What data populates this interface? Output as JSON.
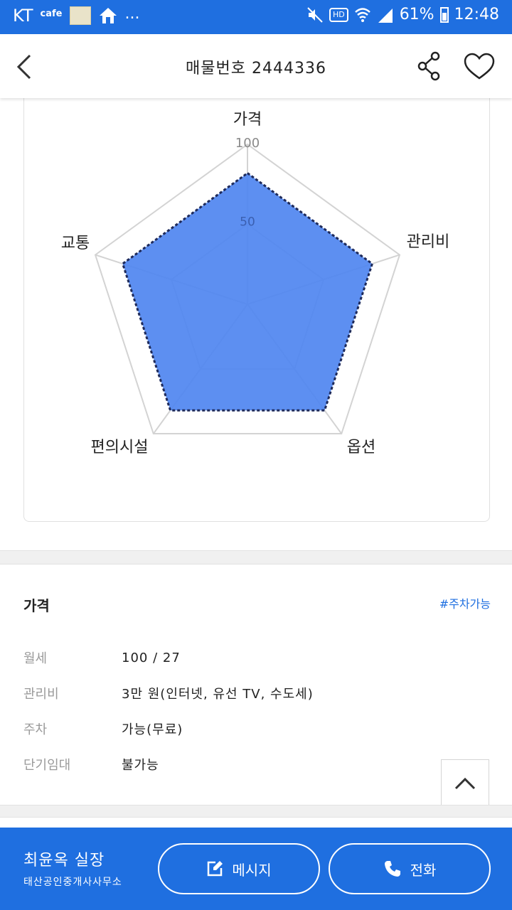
{
  "status_bar": {
    "carrier": "KT",
    "cafe_label": "cafe",
    "more": "...",
    "hd": "HD",
    "battery": "61%",
    "time": "12:48"
  },
  "header": {
    "title": "매물번호 2444336",
    "icons": [
      "back-arrow-icon",
      "share-icon",
      "heart-icon"
    ]
  },
  "radar": {
    "axes": [
      "가격",
      "관리비",
      "옵션",
      "편의시설",
      "교통"
    ],
    "scale_labels": [
      "100",
      "50"
    ],
    "max": 100,
    "values": [
      82,
      82,
      82,
      82,
      82
    ],
    "fill_color": "#4f86f0",
    "outline_color": "#1e2a5a",
    "grid_color": "#d3d3d3"
  },
  "price_section": {
    "title": "가격",
    "tag": "#주차가능",
    "rows": [
      {
        "label": "월세",
        "value": "100 / 27"
      },
      {
        "label": "관리비",
        "value": "3만 원(인터넷, 유선 TV, 수도세)"
      },
      {
        "label": "주차",
        "value": "가능(무료)"
      },
      {
        "label": "단기임대",
        "value": "불가능"
      }
    ]
  },
  "bottom_bar": {
    "agent_name": "최윤옥 실장",
    "agent_office": "태산공인중개사사무소",
    "message_label": "메시지",
    "call_label": "전화",
    "color": "#1f6fe0"
  }
}
